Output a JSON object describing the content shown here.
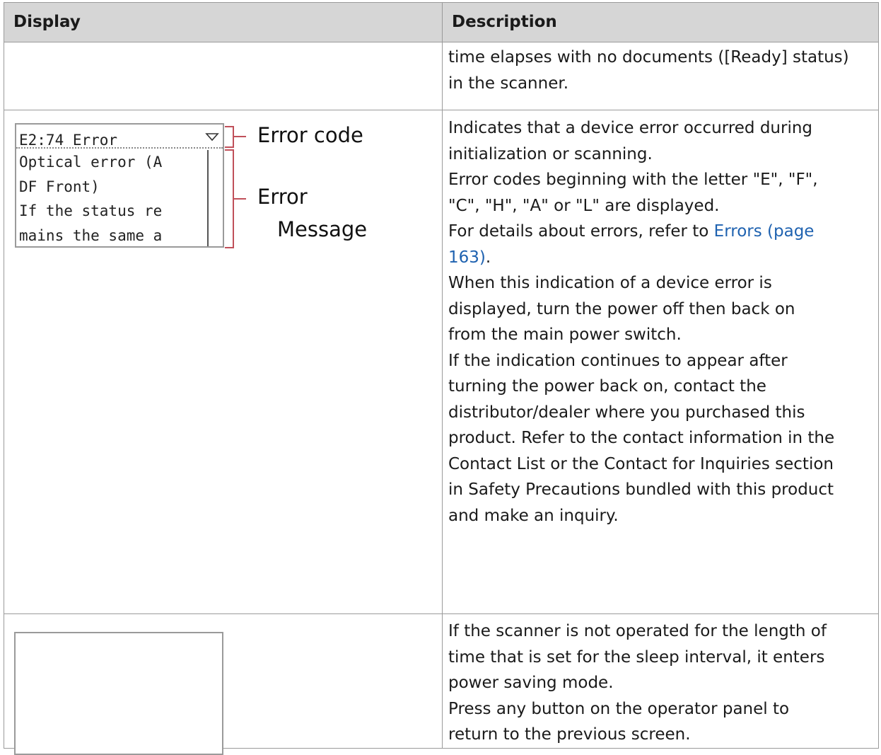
{
  "table": {
    "headers": {
      "display": "Display",
      "description": "Description"
    },
    "rows": [
      {
        "description_lines": [
          "time elapses with no documents ([Ready] status)",
          "in the scanner."
        ]
      },
      {
        "lcd": {
          "code_line": "E2:74 Error",
          "message_lines": [
            "Optical error (A",
            "DF Front)",
            "If the status re",
            "mains the same a"
          ]
        },
        "callouts": {
          "error_code": "Error code",
          "error_message_1": "Error",
          "error_message_2": "Message"
        },
        "description": {
          "line1": "Indicates that a device error occurred during",
          "line2": "initialization or scanning.",
          "line3": "Error codes beginning with the letter \"E\", \"F\",",
          "line4": "\"C\", \"H\", \"A\" or \"L\" are displayed.",
          "line5_prefix": "For details about errors, refer to ",
          "line5_link": "Errors (page",
          "line6_link": "163)",
          "line6_suffix": ".",
          "line7": "When this indication of a device error is",
          "line8": "displayed, turn the power off then back on",
          "line9": "from the main power switch.",
          "line10": "If the indication continues to appear after",
          "line11": "turning the power back on, contact the",
          "line12": "distributor/dealer where you purchased this",
          "line13": "product. Refer to the contact information in the",
          "line14": "Contact List or the Contact for Inquiries section",
          "line15": "in Safety Precautions bundled with this product",
          "line16": "and make an inquiry."
        }
      },
      {
        "description_lines": [
          "If the scanner is not operated for the length of",
          "time that is set for the sleep interval, it enters",
          "power saving mode.",
          "Press any button on the operator panel to",
          "return to the previous screen."
        ]
      }
    ]
  },
  "colors": {
    "header_bg": "#d6d6d6",
    "link": "#1f62b0",
    "bracket": "#c0505a",
    "border": "#9a9a9a"
  },
  "icons": {
    "lcd_arrow": "triangle-down-icon"
  }
}
